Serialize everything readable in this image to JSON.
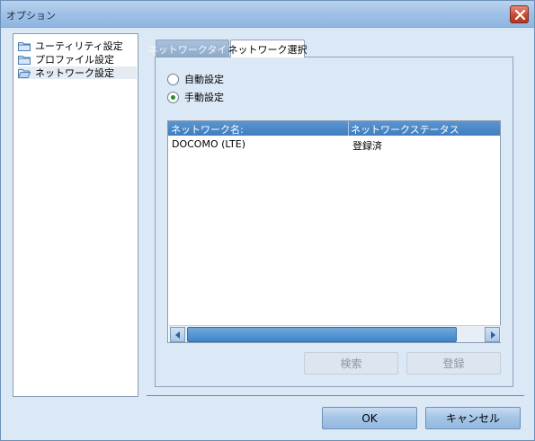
{
  "window": {
    "title": "オプション"
  },
  "sidebar": {
    "items": [
      {
        "label": "ユーティリティ設定",
        "selected": false
      },
      {
        "label": "プロファイル設定",
        "selected": false
      },
      {
        "label": "ネットワーク設定",
        "selected": true
      }
    ]
  },
  "tabs": [
    {
      "label": "ネットワークタイプ",
      "active": false
    },
    {
      "label": "ネットワーク選択",
      "active": true
    }
  ],
  "mode": {
    "options": [
      {
        "label": "自動設定",
        "checked": false
      },
      {
        "label": "手動設定",
        "checked": true
      }
    ]
  },
  "network_table": {
    "columns": [
      "ネットワーク名:",
      "ネットワークステータス"
    ],
    "rows": [
      {
        "name": "DOCOMO (LTE)",
        "status": "登録済"
      }
    ]
  },
  "actions": {
    "search_label": "検索",
    "register_label": "登録"
  },
  "footer": {
    "ok_label": "OK",
    "cancel_label": "キャンセル"
  },
  "colors": {
    "accent": "#3f7ec0",
    "radio_selected": "#2d8a2d",
    "close_button": "#c84a33"
  }
}
